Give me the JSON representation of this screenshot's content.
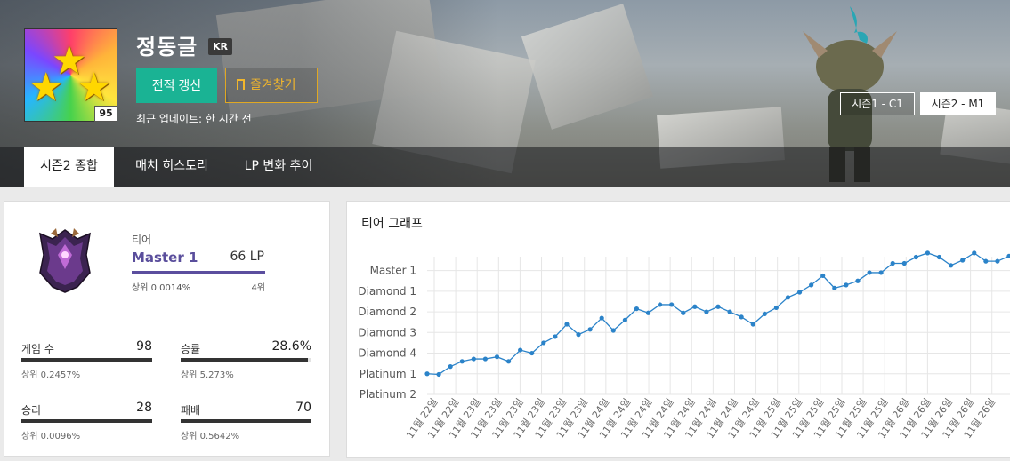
{
  "profile": {
    "name": "정동글",
    "region": "KR",
    "level": "95",
    "refresh_label": "전적 갱신",
    "favorite_label": "즐겨찾기",
    "last_update": "최근 업데이트: 한 시간 전"
  },
  "seasons": [
    "시즌1 - C1",
    "시즌2 - M1"
  ],
  "tabs": [
    "시즌2 종합",
    "매치 히스토리",
    "LP 변화 추이"
  ],
  "tier": {
    "caption": "티어",
    "name": "Master 1",
    "lp": "66 LP",
    "top_percent": "상위 0.0014%",
    "rank": "4위",
    "progress": 1.0
  },
  "stats": [
    {
      "label": "게임 수",
      "value": "98",
      "sub": "상위 0.2457%",
      "fill": 1.0
    },
    {
      "label": "승률",
      "value": "28.6%",
      "sub": "상위 5.273%",
      "fill": 0.97
    },
    {
      "label": "승리",
      "value": "28",
      "sub": "상위 0.0096%",
      "fill": 1.0
    },
    {
      "label": "패배",
      "value": "70",
      "sub": "상위 0.5642%",
      "fill": 1.0
    }
  ],
  "colors": {
    "accent_green": "#1ab394",
    "favorite_gold": "#f1b62c",
    "tier_purple": "#5a4e9c",
    "line_blue": "#2b83c9"
  },
  "chart_panel_title": "티어 그래프",
  "chart_data": {
    "type": "line",
    "title": "티어 그래프",
    "y_tick_labels": [
      "Master 1",
      "Diamond 1",
      "Diamond 2",
      "Diamond 3",
      "Diamond 4",
      "Platinum 1",
      "Platinum 2"
    ],
    "y_tick_values": [
      6,
      5,
      4,
      3,
      2,
      1,
      0
    ],
    "ylim": [
      0,
      6.5
    ],
    "x_tick_labels": [
      "11월 22일",
      "11월 22일",
      "11월 23일",
      "11월 23일",
      "11월 23일",
      "11월 23일",
      "11월 23일",
      "11월 23일",
      "11월 24일",
      "11월 24일",
      "11월 24일",
      "11월 24일",
      "11월 24일",
      "11월 24일",
      "11월 24일",
      "11월 24일",
      "11월 25일",
      "11월 25일",
      "11월 25일",
      "11월 25일",
      "11월 25일",
      "11월 25일",
      "11월 26일",
      "11월 26일",
      "11월 26일",
      "11월 26일",
      "11월 26일"
    ],
    "grid": true,
    "series": [
      {
        "values": [
          1.0,
          0.97,
          1.35,
          1.6,
          1.72,
          1.72,
          1.82,
          1.6,
          2.15,
          2.0,
          2.5,
          2.8,
          3.4,
          2.9,
          3.15,
          3.7,
          3.1,
          3.6,
          4.15,
          3.95,
          4.35,
          4.35,
          3.95,
          4.25,
          4.0,
          4.25,
          4.0,
          3.75,
          3.4,
          3.9,
          4.2,
          4.7,
          4.95,
          5.3,
          5.75,
          5.15,
          5.3,
          5.5,
          5.9,
          5.9,
          6.35,
          6.35,
          6.65,
          6.85,
          6.65,
          6.25,
          6.5,
          6.85,
          6.45,
          6.45,
          6.7
        ]
      }
    ]
  }
}
